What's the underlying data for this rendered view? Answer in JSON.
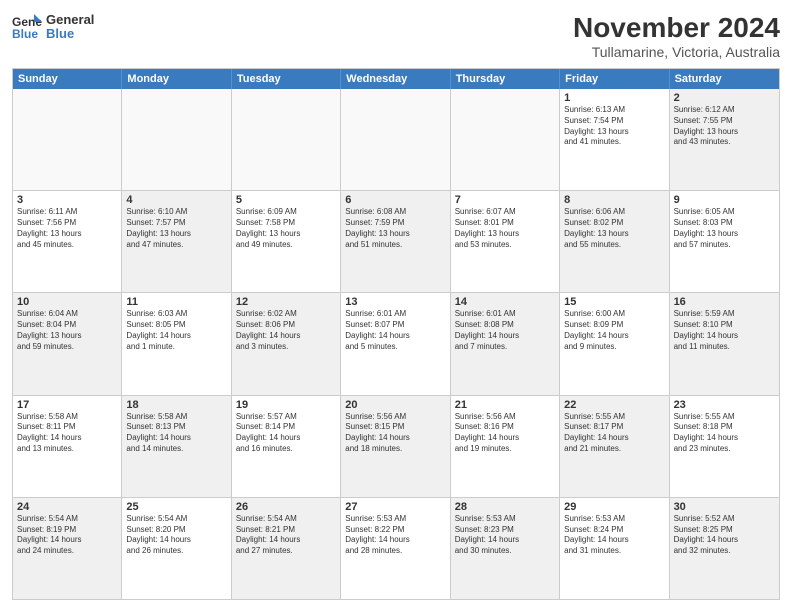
{
  "logo": {
    "line1": "General",
    "line2": "Blue"
  },
  "title": "November 2024",
  "subtitle": "Tullamarine, Victoria, Australia",
  "days": [
    "Sunday",
    "Monday",
    "Tuesday",
    "Wednesday",
    "Thursday",
    "Friday",
    "Saturday"
  ],
  "rows": [
    [
      {
        "day": "",
        "info": "",
        "empty": true
      },
      {
        "day": "",
        "info": "",
        "empty": true
      },
      {
        "day": "",
        "info": "",
        "empty": true
      },
      {
        "day": "",
        "info": "",
        "empty": true
      },
      {
        "day": "",
        "info": "",
        "empty": true
      },
      {
        "day": "1",
        "info": "Sunrise: 6:13 AM\nSunset: 7:54 PM\nDaylight: 13 hours\nand 41 minutes."
      },
      {
        "day": "2",
        "info": "Sunrise: 6:12 AM\nSunset: 7:55 PM\nDaylight: 13 hours\nand 43 minutes.",
        "shaded": true
      }
    ],
    [
      {
        "day": "3",
        "info": "Sunrise: 6:11 AM\nSunset: 7:56 PM\nDaylight: 13 hours\nand 45 minutes."
      },
      {
        "day": "4",
        "info": "Sunrise: 6:10 AM\nSunset: 7:57 PM\nDaylight: 13 hours\nand 47 minutes.",
        "shaded": true
      },
      {
        "day": "5",
        "info": "Sunrise: 6:09 AM\nSunset: 7:58 PM\nDaylight: 13 hours\nand 49 minutes."
      },
      {
        "day": "6",
        "info": "Sunrise: 6:08 AM\nSunset: 7:59 PM\nDaylight: 13 hours\nand 51 minutes.",
        "shaded": true
      },
      {
        "day": "7",
        "info": "Sunrise: 6:07 AM\nSunset: 8:01 PM\nDaylight: 13 hours\nand 53 minutes."
      },
      {
        "day": "8",
        "info": "Sunrise: 6:06 AM\nSunset: 8:02 PM\nDaylight: 13 hours\nand 55 minutes.",
        "shaded": true
      },
      {
        "day": "9",
        "info": "Sunrise: 6:05 AM\nSunset: 8:03 PM\nDaylight: 13 hours\nand 57 minutes."
      }
    ],
    [
      {
        "day": "10",
        "info": "Sunrise: 6:04 AM\nSunset: 8:04 PM\nDaylight: 13 hours\nand 59 minutes.",
        "shaded": true
      },
      {
        "day": "11",
        "info": "Sunrise: 6:03 AM\nSunset: 8:05 PM\nDaylight: 14 hours\nand 1 minute."
      },
      {
        "day": "12",
        "info": "Sunrise: 6:02 AM\nSunset: 8:06 PM\nDaylight: 14 hours\nand 3 minutes.",
        "shaded": true
      },
      {
        "day": "13",
        "info": "Sunrise: 6:01 AM\nSunset: 8:07 PM\nDaylight: 14 hours\nand 5 minutes."
      },
      {
        "day": "14",
        "info": "Sunrise: 6:01 AM\nSunset: 8:08 PM\nDaylight: 14 hours\nand 7 minutes.",
        "shaded": true
      },
      {
        "day": "15",
        "info": "Sunrise: 6:00 AM\nSunset: 8:09 PM\nDaylight: 14 hours\nand 9 minutes."
      },
      {
        "day": "16",
        "info": "Sunrise: 5:59 AM\nSunset: 8:10 PM\nDaylight: 14 hours\nand 11 minutes.",
        "shaded": true
      }
    ],
    [
      {
        "day": "17",
        "info": "Sunrise: 5:58 AM\nSunset: 8:11 PM\nDaylight: 14 hours\nand 13 minutes."
      },
      {
        "day": "18",
        "info": "Sunrise: 5:58 AM\nSunset: 8:13 PM\nDaylight: 14 hours\nand 14 minutes.",
        "shaded": true
      },
      {
        "day": "19",
        "info": "Sunrise: 5:57 AM\nSunset: 8:14 PM\nDaylight: 14 hours\nand 16 minutes."
      },
      {
        "day": "20",
        "info": "Sunrise: 5:56 AM\nSunset: 8:15 PM\nDaylight: 14 hours\nand 18 minutes.",
        "shaded": true
      },
      {
        "day": "21",
        "info": "Sunrise: 5:56 AM\nSunset: 8:16 PM\nDaylight: 14 hours\nand 19 minutes."
      },
      {
        "day": "22",
        "info": "Sunrise: 5:55 AM\nSunset: 8:17 PM\nDaylight: 14 hours\nand 21 minutes.",
        "shaded": true
      },
      {
        "day": "23",
        "info": "Sunrise: 5:55 AM\nSunset: 8:18 PM\nDaylight: 14 hours\nand 23 minutes."
      }
    ],
    [
      {
        "day": "24",
        "info": "Sunrise: 5:54 AM\nSunset: 8:19 PM\nDaylight: 14 hours\nand 24 minutes.",
        "shaded": true
      },
      {
        "day": "25",
        "info": "Sunrise: 5:54 AM\nSunset: 8:20 PM\nDaylight: 14 hours\nand 26 minutes."
      },
      {
        "day": "26",
        "info": "Sunrise: 5:54 AM\nSunset: 8:21 PM\nDaylight: 14 hours\nand 27 minutes.",
        "shaded": true
      },
      {
        "day": "27",
        "info": "Sunrise: 5:53 AM\nSunset: 8:22 PM\nDaylight: 14 hours\nand 28 minutes."
      },
      {
        "day": "28",
        "info": "Sunrise: 5:53 AM\nSunset: 8:23 PM\nDaylight: 14 hours\nand 30 minutes.",
        "shaded": true
      },
      {
        "day": "29",
        "info": "Sunrise: 5:53 AM\nSunset: 8:24 PM\nDaylight: 14 hours\nand 31 minutes."
      },
      {
        "day": "30",
        "info": "Sunrise: 5:52 AM\nSunset: 8:25 PM\nDaylight: 14 hours\nand 32 minutes.",
        "shaded": true
      }
    ]
  ]
}
